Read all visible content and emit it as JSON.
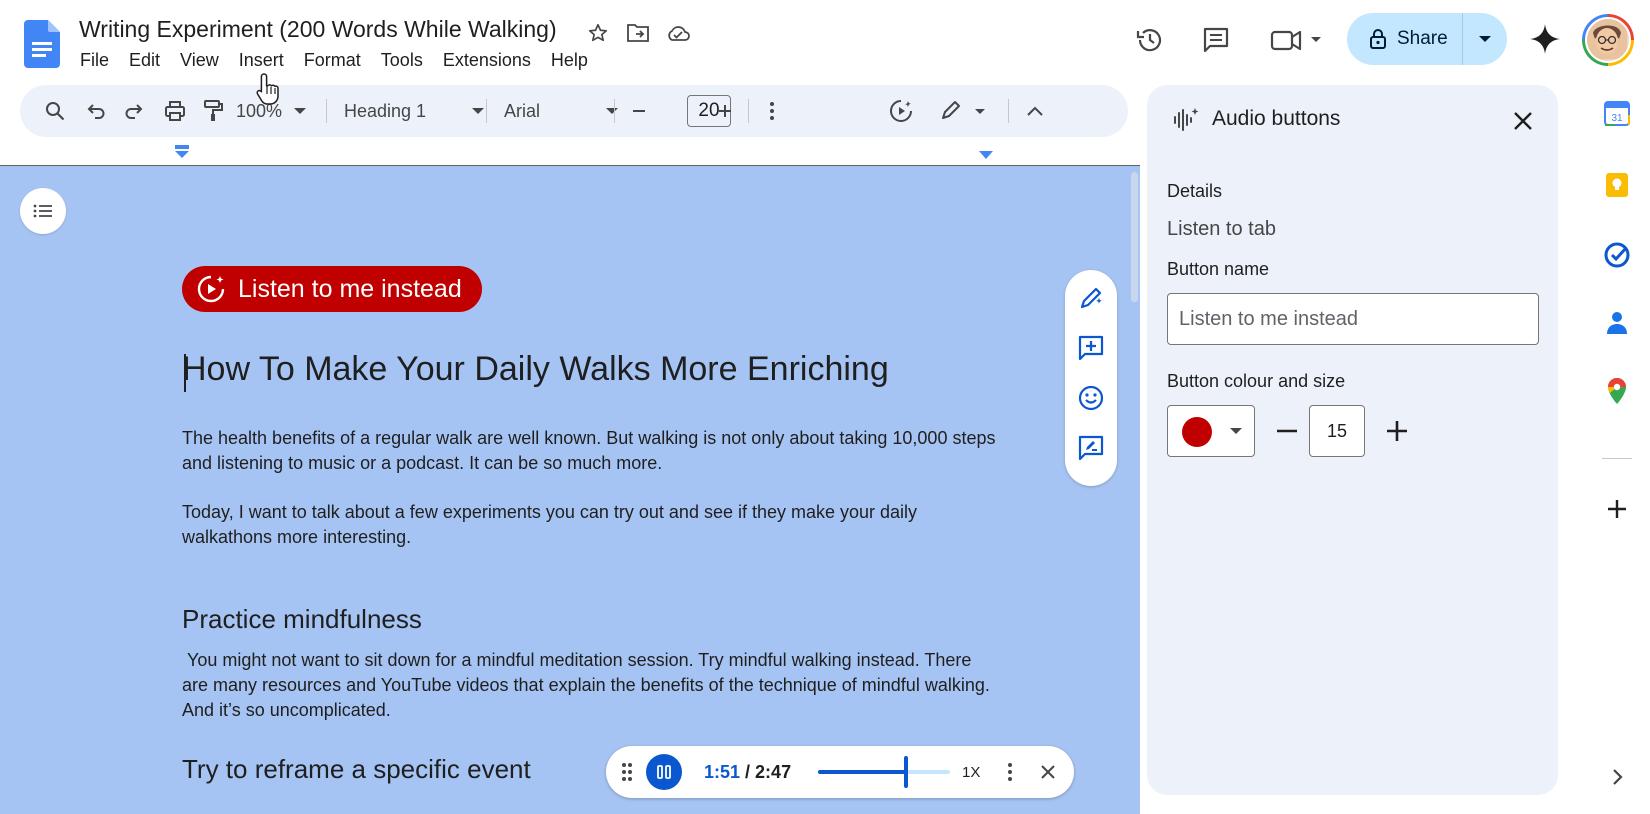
{
  "document": {
    "title": "Writing Experiment (200 Words While Walking)",
    "menu": [
      "File",
      "Edit",
      "View",
      "Insert",
      "Format",
      "Tools",
      "Extensions",
      "Help"
    ]
  },
  "header": {
    "share_label": "Share"
  },
  "toolbar": {
    "zoom": "100%",
    "style": "Heading 1",
    "font": "Arial",
    "font_size": "20"
  },
  "content": {
    "listen_button": "Listen to me instead",
    "heading": "How To Make Your Daily Walks More Enriching",
    "paragraphs": [
      "The health benefits of a regular walk are well known. But walking is not only about taking 10,000 steps and listening to music or a podcast. It can be so much more.",
      "Today, I want to talk about a few experiments you can try out and see if they make your daily walkathons more interesting."
    ],
    "sections": [
      {
        "heading": "Practice mindfulness",
        "text": " You might not want to sit down for a mindful meditation session. Try mindful walking instead. There are many resources and YouTube videos that explain the benefits of the technique of mindful walking. And it’s so uncomplicated."
      },
      {
        "heading": "Try to reframe a specific event"
      }
    ]
  },
  "player": {
    "current": "1:51",
    "separator": " / ",
    "total": "2:47",
    "progress_fraction": 0.665,
    "speed": "1X"
  },
  "panel": {
    "title": "Audio buttons",
    "details_label": "Details",
    "details_value": "Listen to tab",
    "button_name_label": "Button name",
    "button_name_value": "Listen to me instead",
    "colour_size_label": "Button colour and size",
    "button_colour": "#c00000",
    "button_size": "15"
  },
  "colors": {
    "accent": "#0b57d0",
    "share_bg": "#c2e7ff",
    "doc_highlight": "#a6c4f3",
    "listen_chip": "#c00000"
  },
  "icons": [
    "docs-logo-icon",
    "star-icon",
    "move-folder-icon",
    "cloud-icon",
    "history-icon",
    "comments-icon",
    "meet-icon",
    "lock-icon",
    "gemini-icon",
    "search-icon",
    "undo-icon",
    "redo-icon",
    "print-icon",
    "paint-format-icon",
    "more-icon",
    "playback-icon",
    "edit-mode-icon",
    "collapse-icon",
    "outline-icon",
    "play-spark-icon",
    "edit-ai-icon",
    "add-comment-icon",
    "emoji-icon",
    "suggest-icon",
    "drag-handle-icon",
    "pause-icon",
    "close-icon",
    "audio-spark-icon",
    "calendar-icon",
    "keep-icon",
    "tasks-icon",
    "contacts-icon",
    "maps-icon",
    "plus-icon",
    "chevron-right-icon"
  ]
}
